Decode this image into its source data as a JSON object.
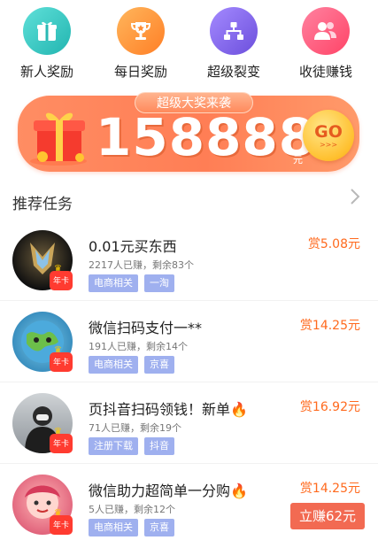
{
  "nav": [
    {
      "label": "新人奖励",
      "icon": "gift-icon",
      "color": "#32c6c1"
    },
    {
      "label": "每日奖励",
      "icon": "trophy-icon",
      "color": "#ff9437"
    },
    {
      "label": "超级裂变",
      "icon": "share-tree-icon",
      "color": "#8363e6"
    },
    {
      "label": "收徒赚钱",
      "icon": "users-icon",
      "color": "#ff5a7e"
    }
  ],
  "banner": {
    "tag": "超级大奖来袭",
    "amount": "158888",
    "unit": "元",
    "go": "GO",
    "go_arrows": ">>>"
  },
  "section": {
    "title": "推荐任务"
  },
  "tasks": [
    {
      "title": "0.01元买东西",
      "sub": "2217人已赚，剩余83个",
      "tags": [
        "电商相关",
        "一淘"
      ],
      "reward": "赏5.08元",
      "badge": "年卡"
    },
    {
      "title": "微信扫码支付一**",
      "sub": "191人已赚，剩余14个",
      "tags": [
        "电商相关",
        "京喜"
      ],
      "reward": "赏14.25元",
      "badge": "年卡"
    },
    {
      "title": "页抖音扫码领钱！新单🔥",
      "sub": "71人已赚，剩余19个",
      "tags": [
        "注册下载",
        "抖音"
      ],
      "reward": "赏16.92元",
      "badge": "年卡"
    },
    {
      "title": "微信助力超简单一分购🔥",
      "sub": "5人已赚，剩余12个",
      "tags": [
        "电商相关",
        "京喜"
      ],
      "reward": "赏14.25元",
      "badge": "年卡"
    }
  ],
  "earn_button": "立赚62元"
}
